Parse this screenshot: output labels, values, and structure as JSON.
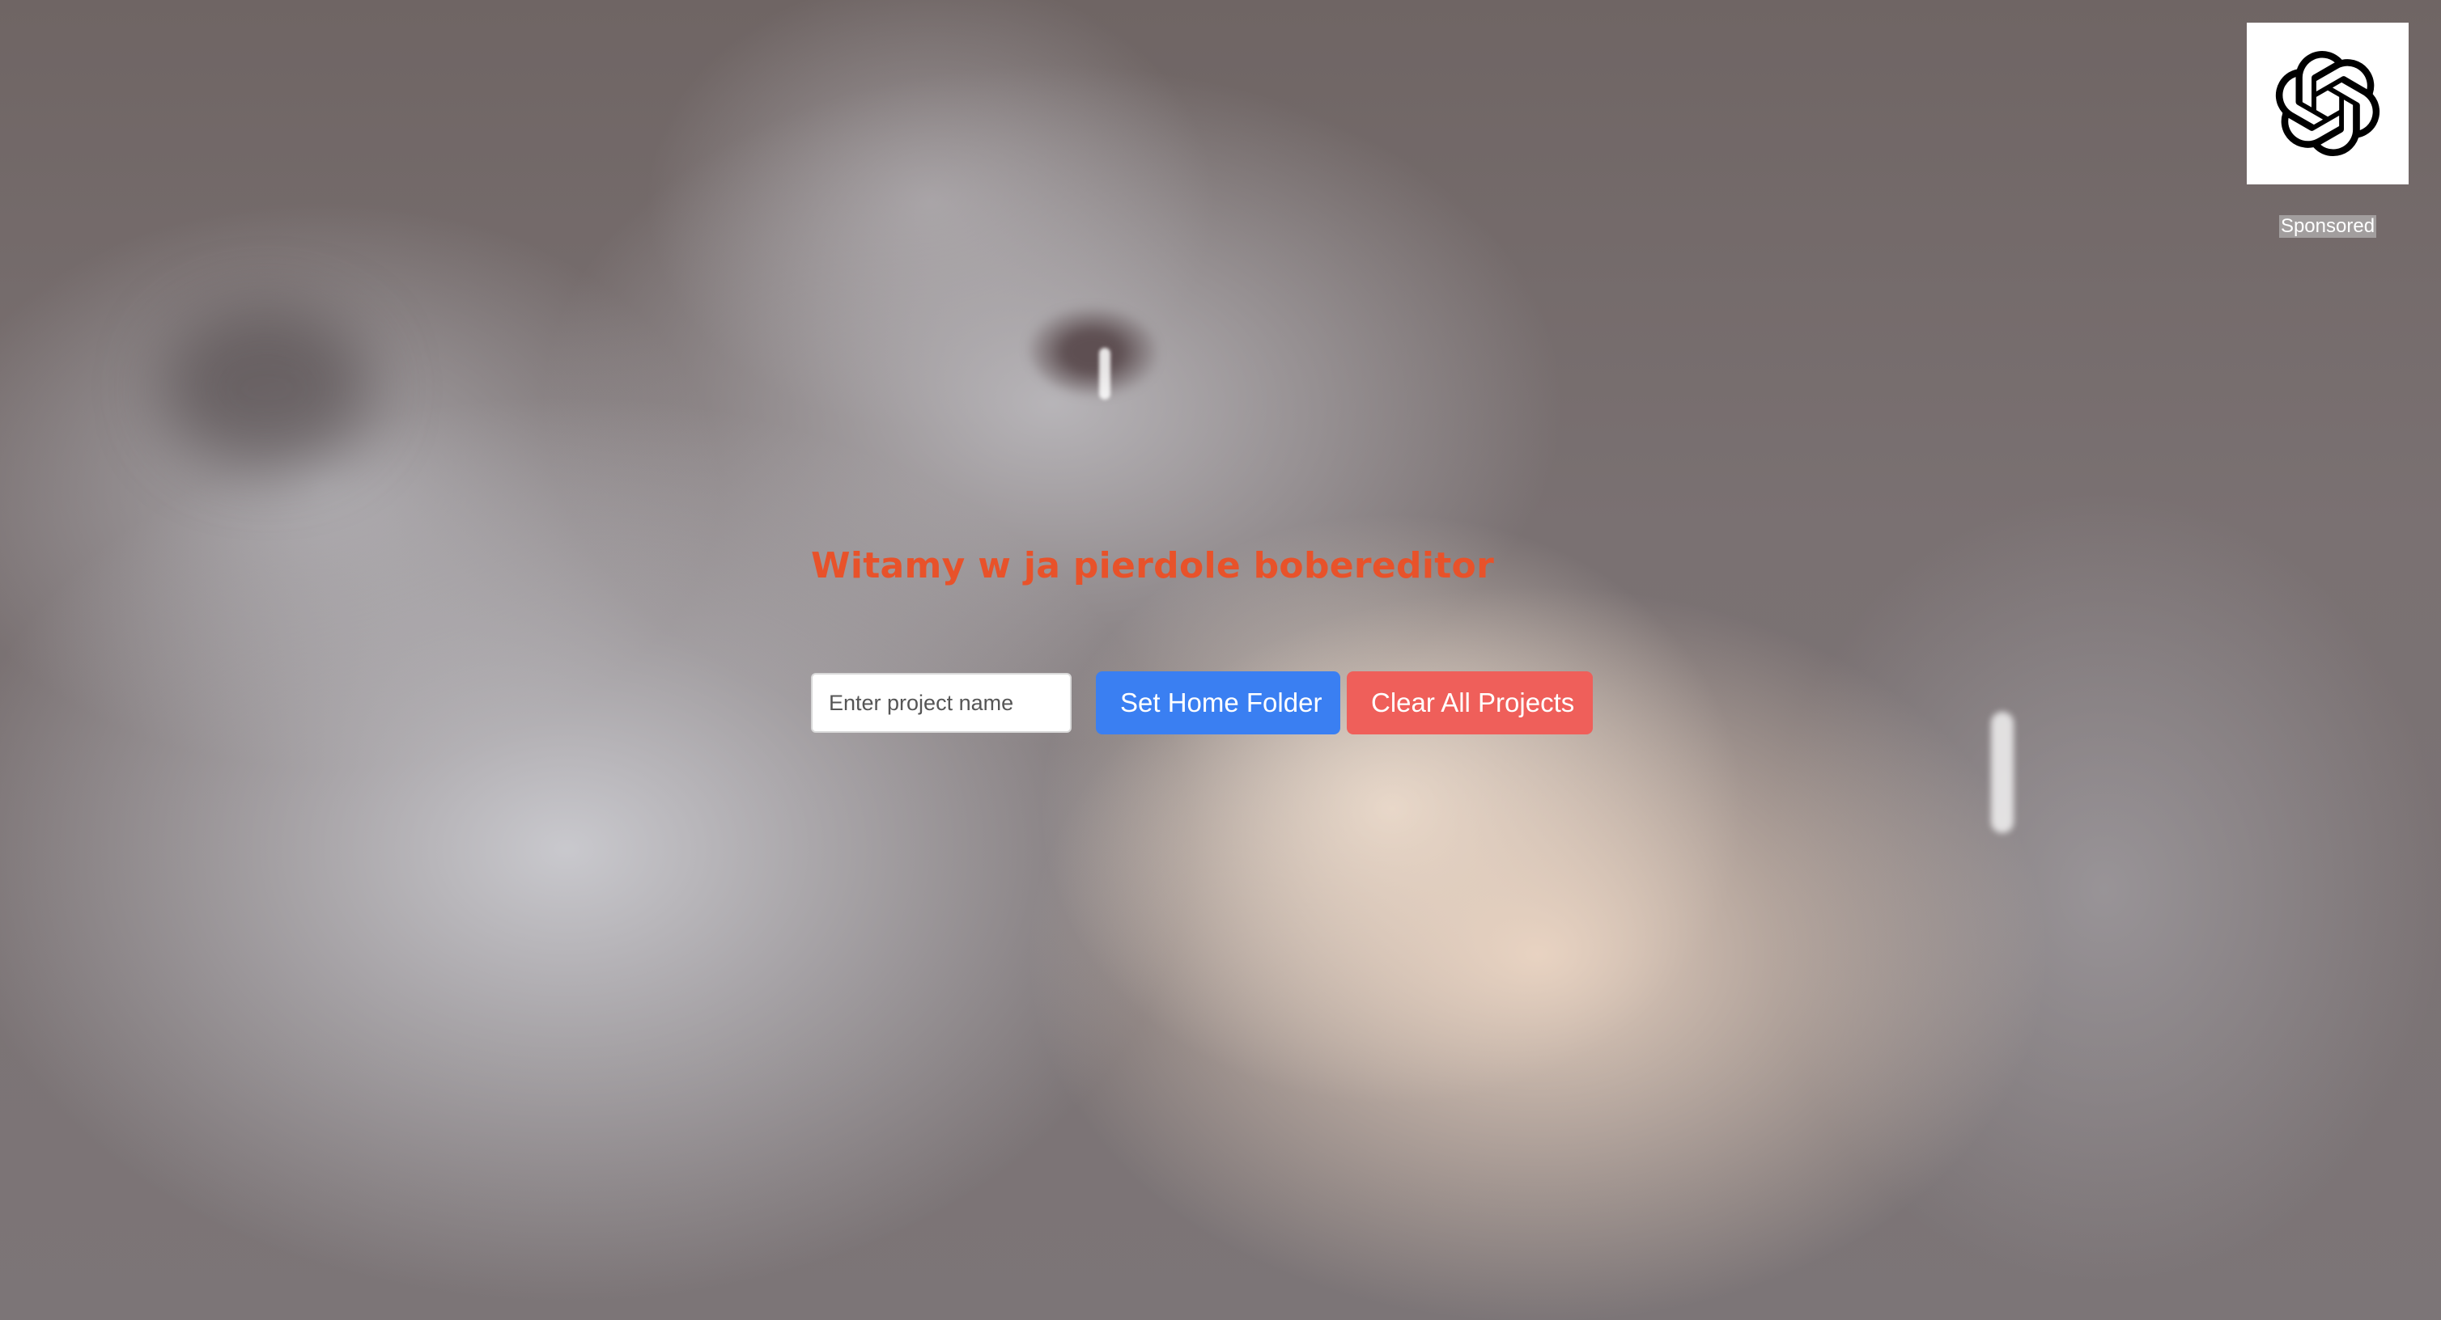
{
  "page": {
    "title": "Witamy w ja pierdole bobereditor"
  },
  "form": {
    "project_name_placeholder": "Enter project name",
    "project_name_value": "",
    "set_home_label": "Set Home Folder",
    "clear_all_label": "Clear All Projects"
  },
  "sponsor": {
    "logo_icon": "openai-knot-logo-icon",
    "label": "Sponsored"
  },
  "colors": {
    "title": "#e8522a",
    "primary_button": "#3a7ff2",
    "danger_button": "#ef5f5a"
  }
}
